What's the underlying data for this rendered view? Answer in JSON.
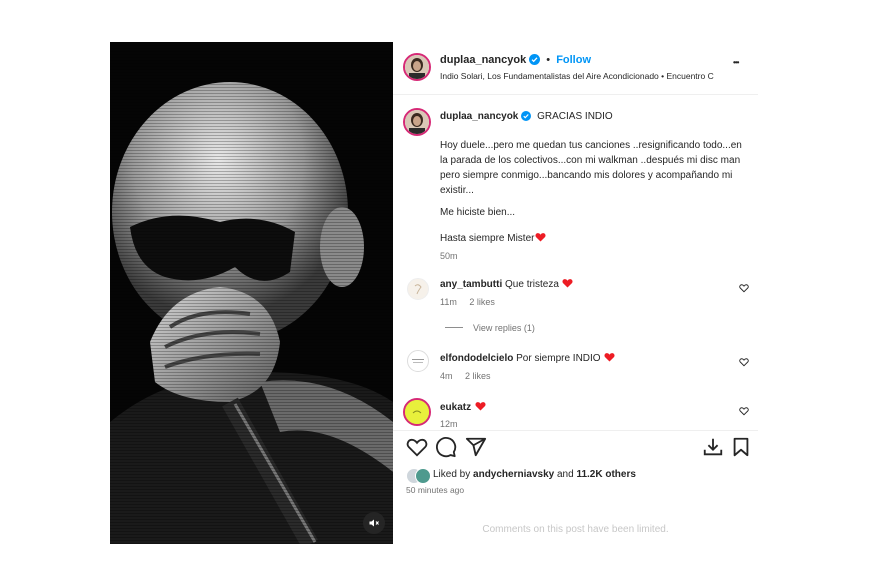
{
  "header": {
    "username": "duplaa_nancyok",
    "separator": "•",
    "follow_label": "Follow",
    "audio": "Indio Solari, Los Fundamentalistas del Aire Acondicionado • Encuentro C",
    "more_label": "•••"
  },
  "post_caption": {
    "username": "duplaa_nancyok",
    "title": "GRACIAS INDIO",
    "paragraph1": "Hoy duele...pero me quedan tus canciones ..resignificando todo...en la parada de los colectivos...con mi walkman ..después mi disc man pero siempre conmigo...bancando mis dolores y acompañando mi existir...",
    "paragraph2": "Me hiciste bien...",
    "paragraph3": "Hasta siempre Mister",
    "time": "50m"
  },
  "comments": [
    {
      "username": "any_tambutti",
      "text": "Que tristeza",
      "time": "11m",
      "likes": "2 likes",
      "view_replies": "View replies (1)"
    },
    {
      "username": "elfondodelcielo",
      "text": "Por siempre INDIO",
      "time": "4m",
      "likes": "2 likes"
    },
    {
      "username": "eukatz",
      "text": "",
      "time": "12m"
    }
  ],
  "footer": {
    "liked_prefix": "Liked by",
    "liked_user": "andycherniavsky",
    "liked_and": "and",
    "liked_others": "11.2K others",
    "posted_ago": "50 minutes ago",
    "limited_notice": "Comments on this post have been limited."
  },
  "colors": {
    "link_blue": "#0095f6",
    "heart_red": "#ed1c24",
    "verified_blue": "#0095f6",
    "ring_pink": "#d62976",
    "muted_gray": "#737373"
  }
}
